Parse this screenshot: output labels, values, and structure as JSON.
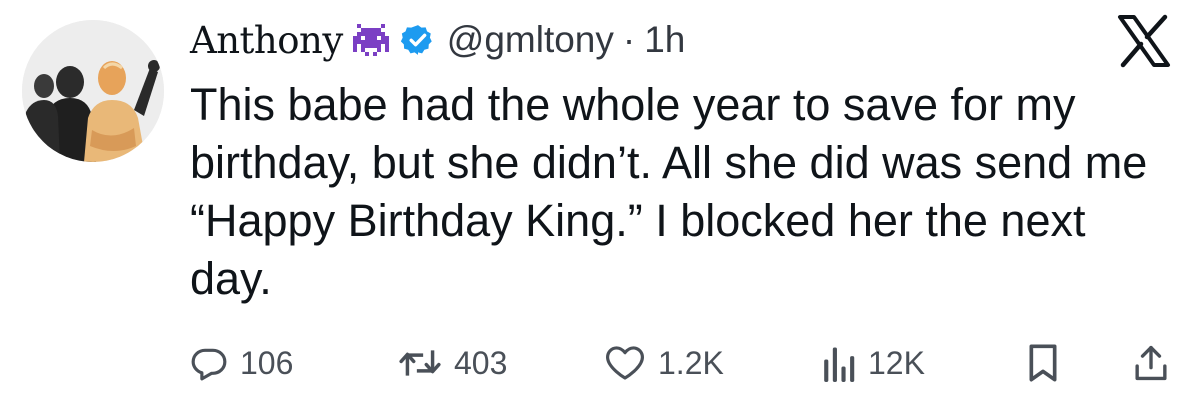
{
  "author": {
    "display_name": "Anthony",
    "name_emoji": "alien-monster-icon",
    "verified": true,
    "handle": "@gmltony",
    "separator": "·",
    "time": "1h"
  },
  "tweet": {
    "text": "This babe had the whole year to save for my birthday, but she didn’t. All she did was send me “Happy Birthday King.” I blocked her the next day."
  },
  "actions": {
    "replies": "106",
    "reposts": "403",
    "likes": "1.2K",
    "views": "12K"
  },
  "icons": {
    "reply": "reply-icon",
    "repost": "repost-icon",
    "like": "like-icon",
    "views": "views-icon",
    "bookmark": "bookmark-icon",
    "share": "share-icon",
    "brand": "x-logo-icon"
  },
  "colors": {
    "verified": "#1d9bf0",
    "emoji": "#7b3fc4",
    "text": "#0f1419",
    "muted": "#4a5058"
  }
}
